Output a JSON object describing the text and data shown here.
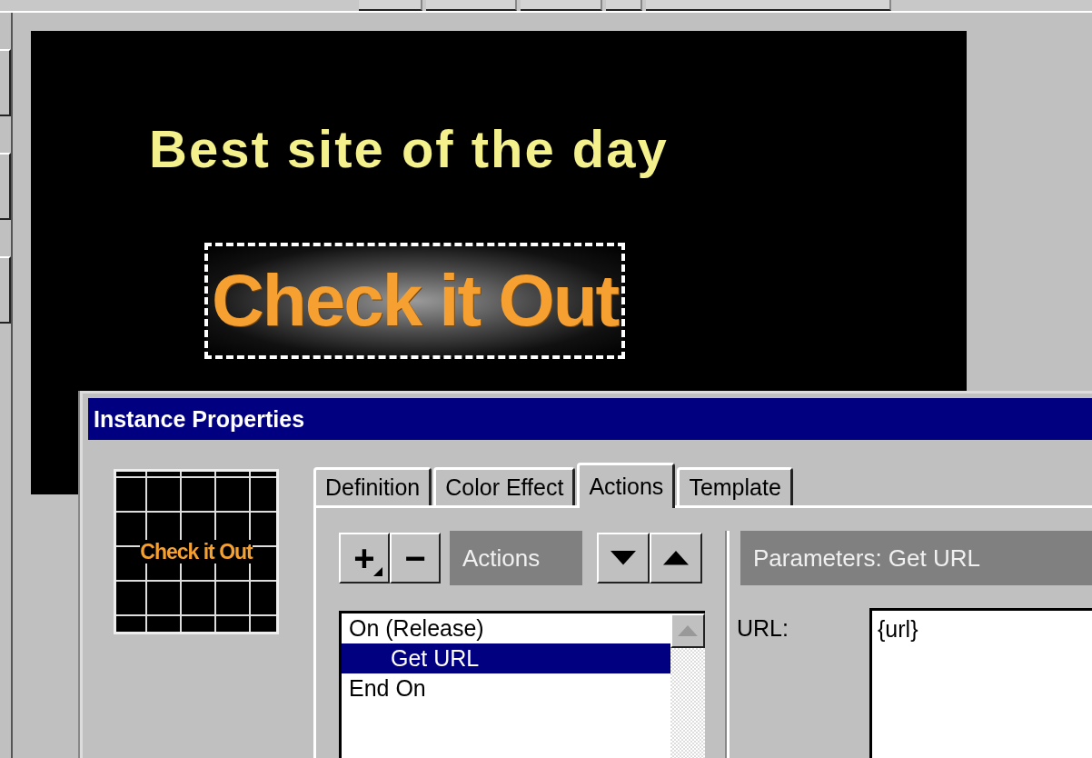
{
  "stage": {
    "headline": "Best site of the day",
    "button_label": "Check it Out",
    "button_selected": true
  },
  "dialog": {
    "title": "Instance Properties",
    "preview_label": "Check it Out",
    "tabs": [
      {
        "label": "Definition",
        "selected": false
      },
      {
        "label": "Color Effect",
        "selected": false
      },
      {
        "label": "Actions",
        "selected": true
      },
      {
        "label": "Template",
        "selected": false
      }
    ],
    "add_button": "+",
    "remove_button": "−",
    "actions_header": "Actions",
    "actions": [
      {
        "label": "On (Release)",
        "selected": false,
        "children": [
          {
            "label": "Get URL",
            "selected": true
          }
        ]
      },
      {
        "label": "End On",
        "selected": false
      }
    ],
    "parameters_header": "Parameters: Get URL",
    "url_label": "URL:",
    "url_value": "{url}"
  }
}
